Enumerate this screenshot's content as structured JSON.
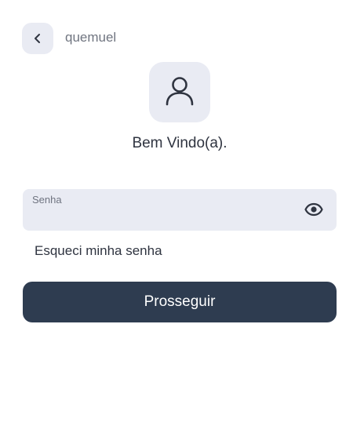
{
  "header": {
    "back_icon": "chevron-left-icon",
    "username": "quemuel"
  },
  "profile": {
    "avatar_icon": "user-icon",
    "welcome_text": "Bem Vindo(a)."
  },
  "form": {
    "password_label": "Senha",
    "password_value": "",
    "toggle_icon": "eye-icon",
    "forgot_link": "Esqueci minha senha",
    "submit_label": "Prosseguir"
  },
  "colors": {
    "surface": "#e9ebf3",
    "primary": "#2e3c50",
    "text": "#2f3440",
    "muted": "#707580"
  }
}
